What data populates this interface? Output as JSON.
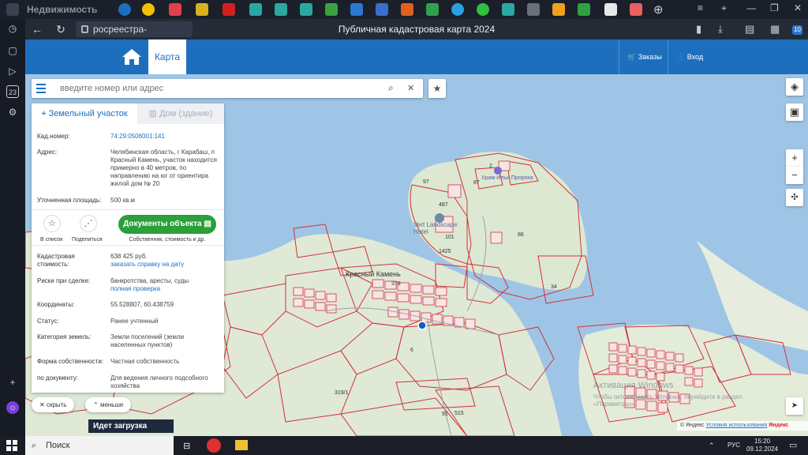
{
  "browser": {
    "first_tab_title": "Недвижимость",
    "url": "росреестра-выписка.рус",
    "page_title": "Публичная кадастровая карта 2024",
    "extensions_badge": "10"
  },
  "sidebar_badge": "23",
  "header": {
    "map_tab": "Карта",
    "orders": "Заказы",
    "login": "Вход"
  },
  "search": {
    "placeholder": "введите номер или адрес"
  },
  "panel": {
    "tabs": [
      "Земельный участок",
      "Дом (здание)"
    ],
    "cad_number_label": "Кад.номер:",
    "cad_number": "74:29:0506001:141",
    "address_label": "Адрес:",
    "address": "Челябинская область, г Карабаш, п Красный Камень, участок находится примерно в 40 метров, по направлению на юг от ориентира жилой дом № 20",
    "area_label": "Уточненная площадь:",
    "area": "500 кв.м",
    "add_list": "В список",
    "share": "Поделиться",
    "docs_button": "Документы объекта",
    "docs_sub": "Собственник, стоимость и др.",
    "cost_label": "Кадастровая стоимость:",
    "cost": "638 425 руб.",
    "cost_link": "заказать справку на дату",
    "risks_label": "Риски при сделке:",
    "risks": "банкротства, аресты, суды",
    "risks_link": "полная проверка",
    "coords_label": "Координаты:",
    "coords": "55.528807, 60.438759",
    "status_label": "Статус:",
    "status": "Ранее учтенный",
    "category_label": "Категория земель:",
    "category": "Земли поселений (земли населенных пунктов)",
    "ownership_label": "Форма собственности:",
    "ownership": "Частная собственность",
    "by_doc_label": "по документу:",
    "by_doc": "Для ведения личного подсобного хозяйства"
  },
  "map_buttons": {
    "hide": "скрыть",
    "less": "меньше",
    "zoom_in": "+",
    "zoom_out": "−"
  },
  "map_labels": {
    "village": "Красный Камень",
    "hotel": "Vert Landscape Hotel",
    "chapel": "Храм Ильи Пророка",
    "parcels": [
      "487",
      "97",
      "101",
      "1425",
      "86",
      "34",
      "379",
      "6",
      "319/1",
      "515",
      "91",
      "2",
      "87"
    ]
  },
  "loading": "Идет загрузка слоя...",
  "watermark": [
    "Активация Windows",
    "Чтобы активировать Windows, перейдите в раздел «Параметры»."
  ],
  "attribution": {
    "logo": "© Яндекс",
    "terms": "Условия использования",
    "brand": "Яндекс"
  },
  "taskbar": {
    "search": "Поиск",
    "lang": "РУС",
    "time": "15:20",
    "date": "09.12.2024"
  }
}
